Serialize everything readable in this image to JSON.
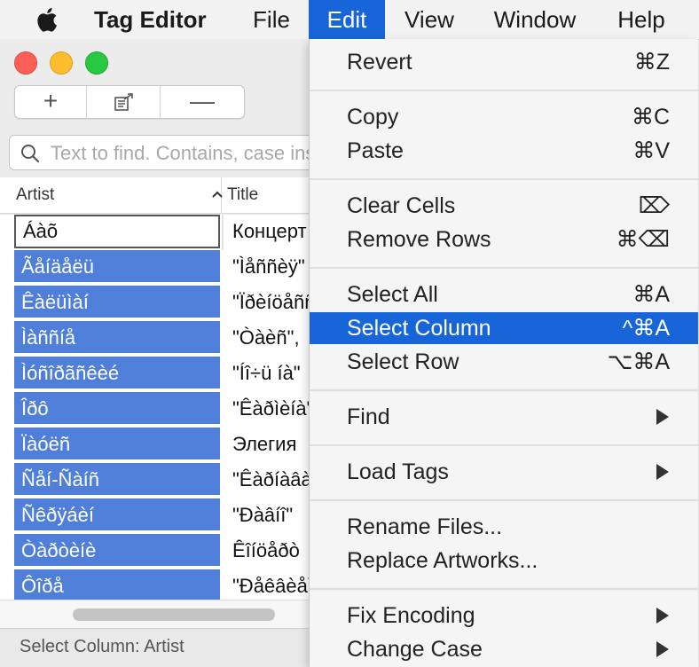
{
  "menubar": {
    "app_name": "Tag Editor",
    "items": [
      "File",
      "Edit",
      "View",
      "Window",
      "Help"
    ],
    "active": "Edit"
  },
  "toolbar": {
    "add_label": "+",
    "remove_label": "—"
  },
  "search": {
    "placeholder": "Text to find. Contains, case insensitive"
  },
  "table": {
    "columns": [
      "Artist",
      "Title"
    ],
    "sort": "ascending",
    "rows": [
      {
        "artist": "Áàõ",
        "title": "Концерт"
      },
      {
        "artist": "Ãåíäåëü",
        "title": "\"Ìåññèÿ\""
      },
      {
        "artist": "Êàëüìàí",
        "title": "\"Ïðèíöåññà\""
      },
      {
        "artist": "Ìàññíå",
        "title": "\"Òàèñ\","
      },
      {
        "artist": "Ìóñîðãñêèé",
        "title": "\"Íî÷ü íà\""
      },
      {
        "artist": "Îðô",
        "title": "\"Êàðìèíà\""
      },
      {
        "artist": "Ïàóëñ",
        "title": "Элегия"
      },
      {
        "artist": "Ñåí-Ñàíñ",
        "title": "\"Êàðíàâàë\""
      },
      {
        "artist": "Ñêðÿáèí",
        "title": "\"Ðàâíî\""
      },
      {
        "artist": "Òàðòèíè",
        "title": "Êîíöåðò"
      },
      {
        "artist": "Ôîðå",
        "title": "\"Ðåêâèåì\""
      }
    ]
  },
  "status": "Select Column: Artist",
  "edit_menu": {
    "groups": [
      [
        {
          "label": "Revert",
          "shortcut": "⌘Z"
        }
      ],
      [
        {
          "label": "Copy",
          "shortcut": "⌘C"
        },
        {
          "label": "Paste",
          "shortcut": "⌘V"
        }
      ],
      [
        {
          "label": "Clear Cells",
          "shortcut": "⌦"
        },
        {
          "label": "Remove Rows",
          "shortcut": "⌘⌫"
        }
      ],
      [
        {
          "label": "Select All",
          "shortcut": "⌘A"
        },
        {
          "label": "Select Column",
          "shortcut": "^⌘A"
        },
        {
          "label": "Select Row",
          "shortcut": "⌥⌘A"
        }
      ],
      [
        {
          "label": "Find",
          "shortcut": ""
        }
      ],
      [
        {
          "label": "Load Tags",
          "shortcut": ""
        }
      ],
      [
        {
          "label": "Rename Files...",
          "shortcut": ""
        },
        {
          "label": "Replace Artworks...",
          "shortcut": ""
        }
      ],
      [
        {
          "label": "Fix Encoding",
          "shortcut": ""
        },
        {
          "label": "Change Case",
          "shortcut": ""
        }
      ]
    ],
    "highlighted": "Select Column"
  },
  "colors": {
    "accent": "#1865d9",
    "selection": "#4f7fd8"
  }
}
